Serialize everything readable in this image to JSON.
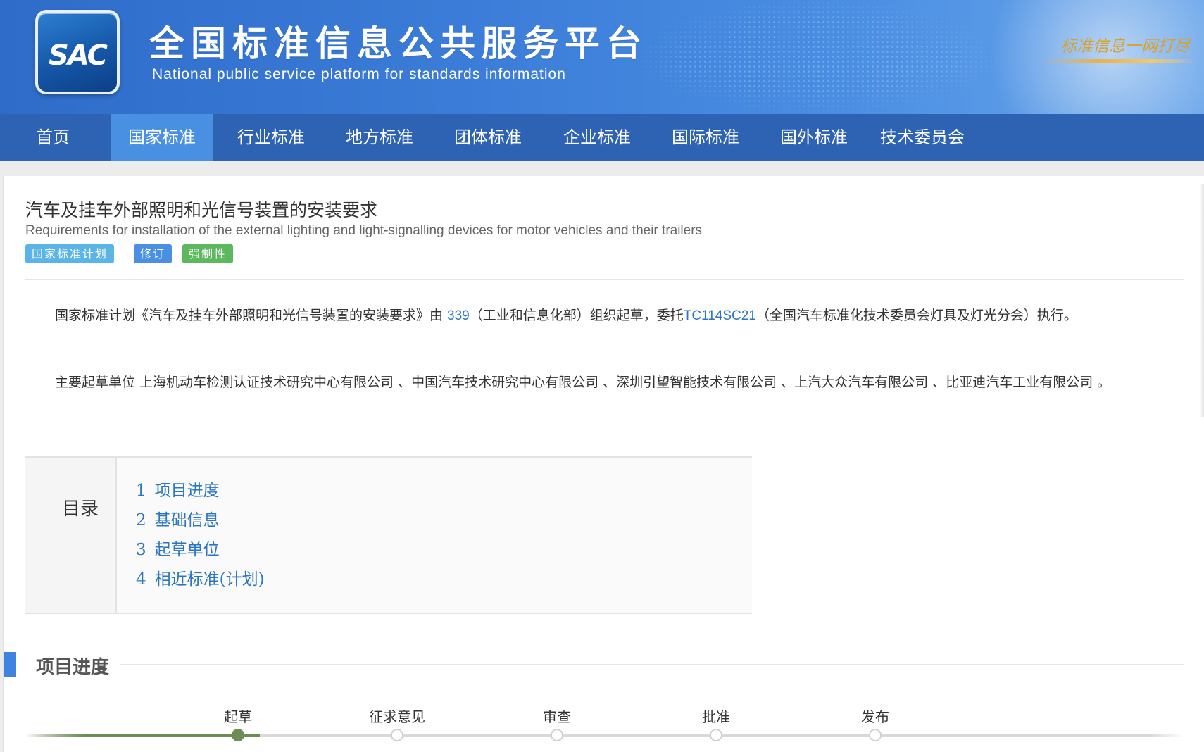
{
  "header": {
    "logo_text": "SAC",
    "title": "全国标准信息公共服务平台",
    "subtitle": "National public service platform  for standards information",
    "slogan": "标准信息一网打尽"
  },
  "nav": {
    "items": [
      "首页",
      "国家标准",
      "行业标准",
      "地方标准",
      "团体标准",
      "企业标准",
      "国际标准",
      "国外标准",
      "技术委员会"
    ],
    "active_index": 1
  },
  "standard": {
    "title": "汽车及挂车外部照明和光信号装置的安装要求",
    "title_en": "Requirements for installation of the external lighting and light-signalling devices for motor vehicles and their trailers",
    "tags": [
      {
        "label": "国家标准计划",
        "color": "#5bb4e6"
      },
      {
        "label": "修订",
        "color": "#4a90e2"
      },
      {
        "label": "强制性",
        "color": "#5cb85c"
      }
    ]
  },
  "description": {
    "p1_a": "国家标准计划《汽车及挂车外部照明和光信号装置的安装要求》由 ",
    "p1_link1": "339",
    "p1_b": "（工业和信息化部）组织起草，委托",
    "p1_link2": "TC114SC21",
    "p1_c": "（全国汽车标准化技术委员会灯具及灯光分会）执行。",
    "p2": "主要起草单位 上海机动车检测认证技术研究中心有限公司 、中国汽车技术研究中心有限公司 、深圳引望智能技术有限公司 、上汽大众汽车有限公司 、比亚迪汽车工业有限公司 。"
  },
  "toc": {
    "heading": "目录",
    "items": [
      {
        "num": "1",
        "label": "项目进度"
      },
      {
        "num": "2",
        "label": "基础信息"
      },
      {
        "num": "3",
        "label": "起草单位"
      },
      {
        "num": "4",
        "label": "相近标准(计划)"
      }
    ]
  },
  "progress": {
    "section_title": "项目进度",
    "steps": [
      "起草",
      "征求意见",
      "审查",
      "批准",
      "发布"
    ],
    "current_step": 0
  },
  "colors": {
    "banner": "#3b7dd8",
    "nav": "#2e63b4",
    "nav_active": "#4a90e2",
    "link": "#2b76c2",
    "progress_done": "#6b8e52"
  }
}
